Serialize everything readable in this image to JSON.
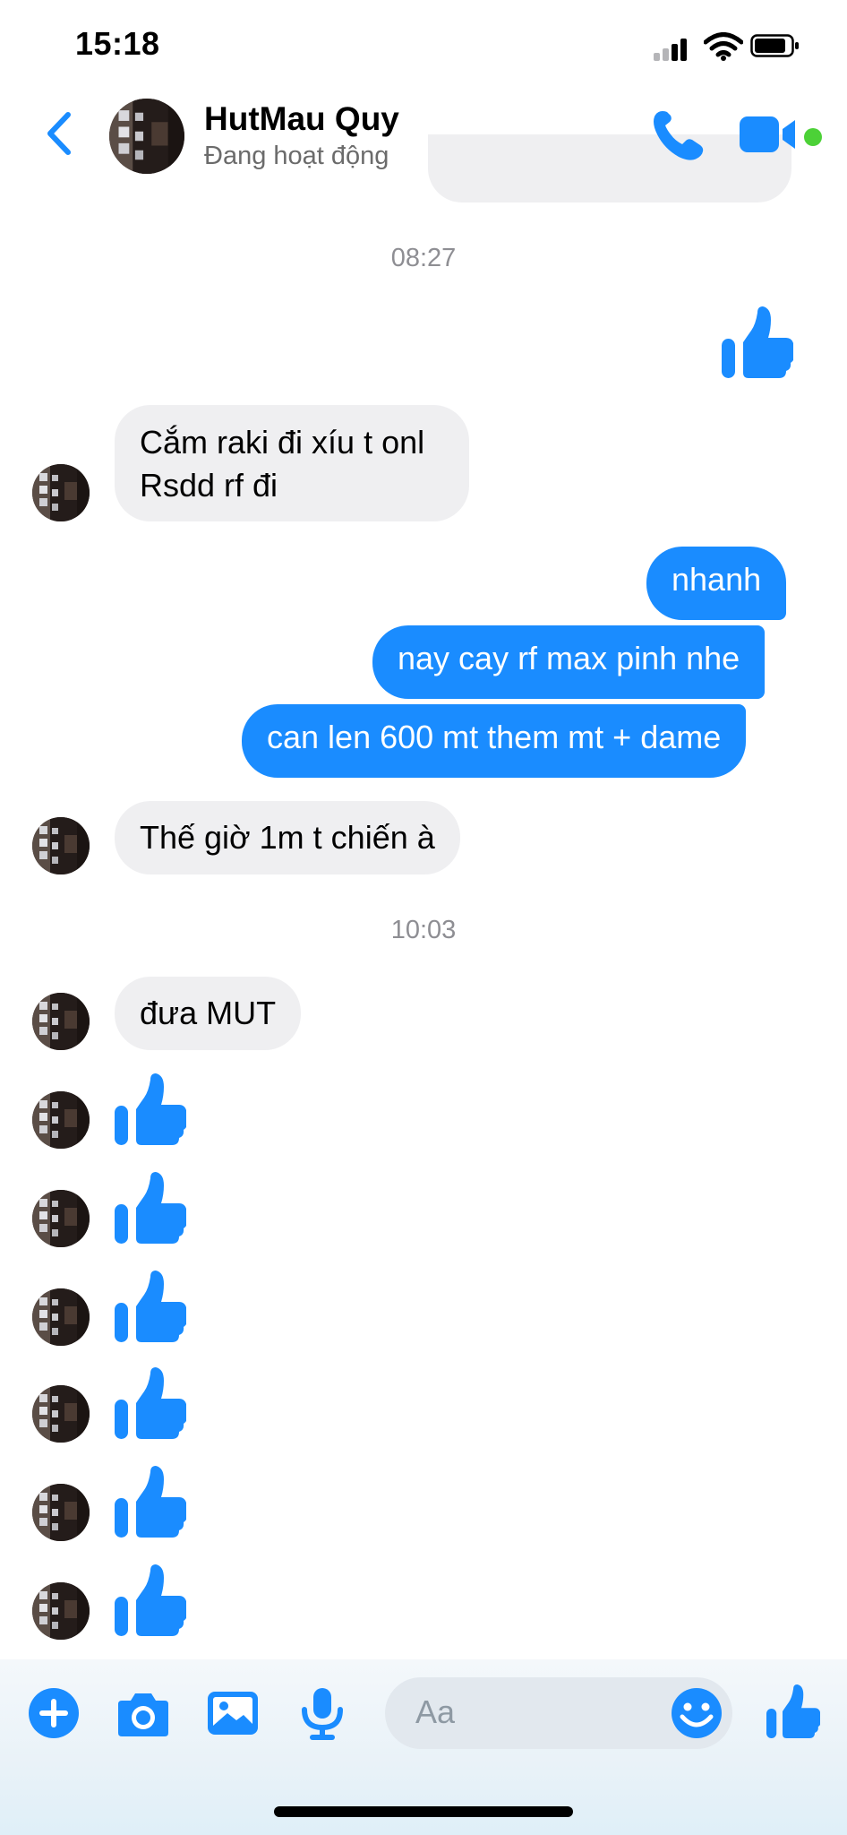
{
  "status_bar": {
    "time": "15:18"
  },
  "header": {
    "contact_name": "HutMau Quy",
    "presence": "Đang hoạt động"
  },
  "messages": {
    "ts1": "08:27",
    "in1_line1": "Cắm raki đi xíu t onl",
    "in1_line2": "Rsdd rf đi",
    "out1": "nhanh",
    "out2": "nay cay rf max pinh nhe",
    "out3": "can len 600 mt them mt + dame",
    "in2": "Thế giờ 1m t chiến à",
    "ts2": "10:03",
    "in3": "đưa MUT"
  },
  "composer": {
    "placeholder": "Aa"
  },
  "colors": {
    "accent": "#1a8cff",
    "incoming_bubble": "#efeff1",
    "online": "#4cd137"
  },
  "icons": [
    "back-chevron-icon",
    "phone-icon",
    "video-icon",
    "plus-icon",
    "camera-icon",
    "image-icon",
    "microphone-icon",
    "emoji-icon",
    "thumbs-up-icon"
  ]
}
